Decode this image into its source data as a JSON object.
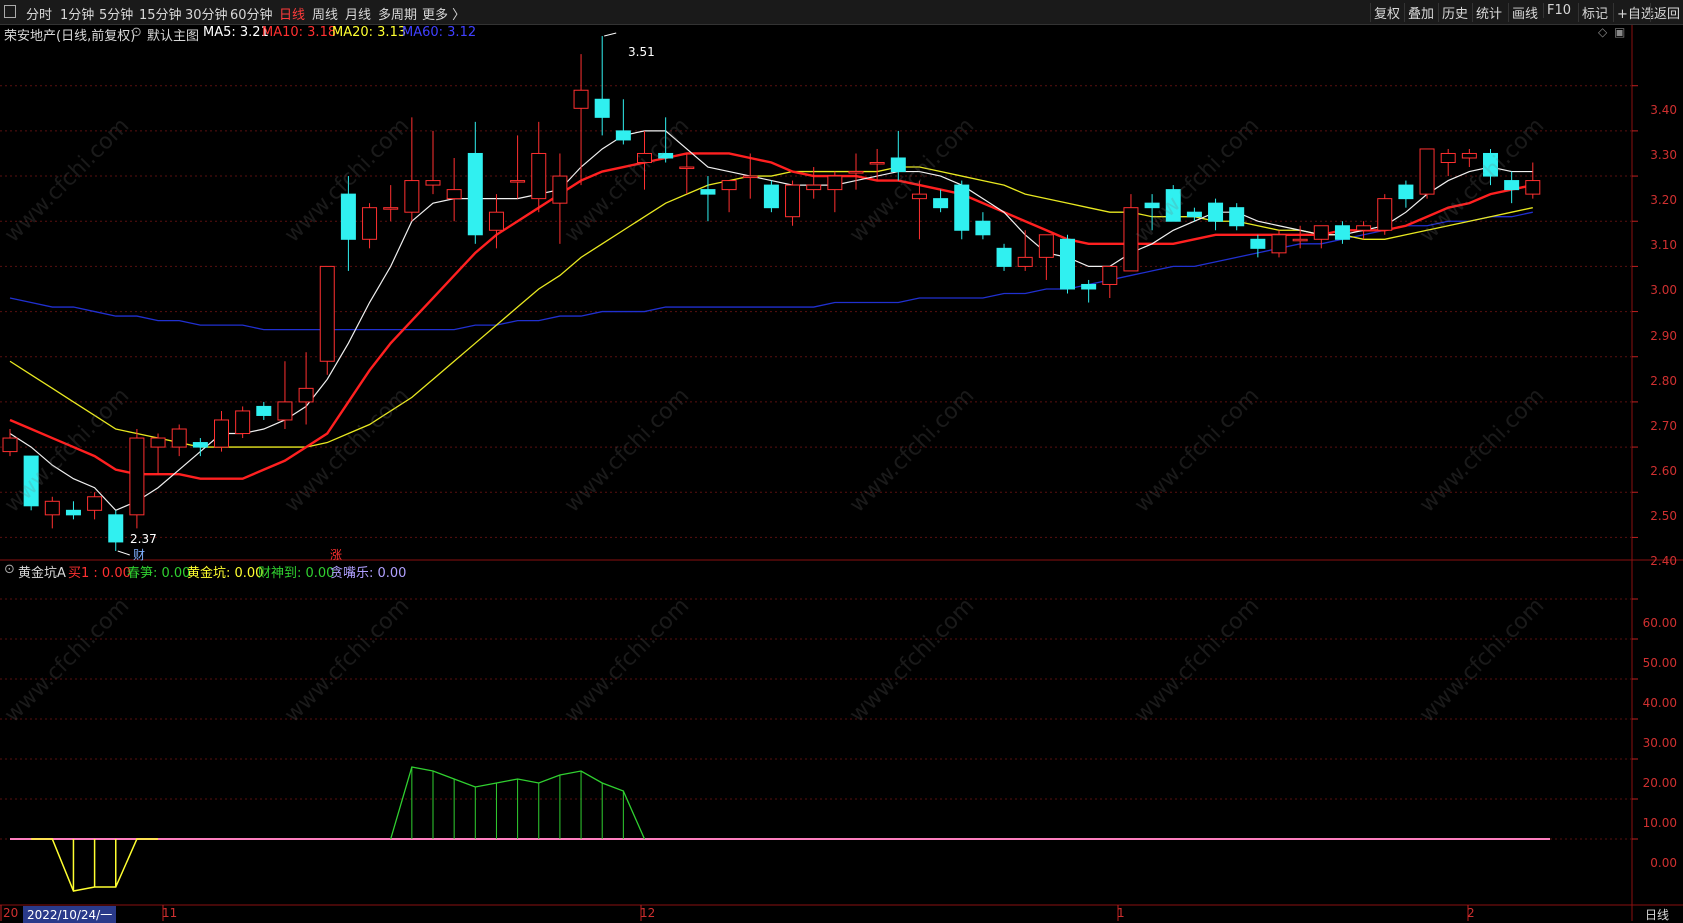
{
  "toolbar": {
    "left_items": [
      "分时",
      "1分钟",
      "5分钟",
      "15分钟",
      "30分钟",
      "60分钟",
      "日线",
      "周线",
      "月线",
      "多周期",
      "更多 〉"
    ],
    "active_item": "日线",
    "right_items": [
      "复权",
      "叠加",
      "历史",
      "统计",
      "画线",
      "F10",
      "标记",
      "+自选",
      "返回"
    ]
  },
  "main_panel": {
    "stock_name": "荣安地产(日线,前复权)",
    "indicator_name": "默认主图",
    "ma_labels": [
      {
        "text": "MA5: 3.21",
        "color": "#ffffff"
      },
      {
        "text": "MA10: 3.18",
        "color": "#ff3030"
      },
      {
        "text": "MA20: 3.13",
        "color": "#ffff30"
      },
      {
        "text": "MA60: 3.12",
        "color": "#4040ff"
      }
    ],
    "high_label": "3.51",
    "low_label": "2.37",
    "marker_cai": "财",
    "marker_zhang": "涨",
    "y_axis": [
      "3.40",
      "3.30",
      "3.20",
      "3.10",
      "3.00",
      "2.90",
      "2.80",
      "2.70",
      "2.60",
      "2.50",
      "2.40"
    ]
  },
  "sub_panel": {
    "indicator_name": "黄金坑A",
    "values": [
      {
        "text": "买1 : 0.00",
        "color": "#ff3030"
      },
      {
        "text": "春笋: 0.00",
        "color": "#30d030"
      },
      {
        "text": "黄金坑: 0.00",
        "color": "#ffff30"
      },
      {
        "text": "财神到: 0.00",
        "color": "#30d030"
      },
      {
        "text": "贪嘴乐: 0.00",
        "color": "#b0a0ff"
      }
    ],
    "y_axis": [
      "60.00",
      "50.00",
      "40.00",
      "30.00",
      "20.00",
      "10.00",
      "0.00"
    ]
  },
  "x_axis": {
    "date_label": "2022/10/24/一",
    "month_labels": [
      "20",
      "11",
      "12",
      "1",
      "2"
    ],
    "period_label": "日线"
  },
  "watermark": "www.cfchi.com",
  "chart_data": {
    "type": "candlestick",
    "title": "荣安地产(日线,前复权)",
    "ylim": [
      2.35,
      3.53
    ],
    "candles": [
      {
        "o": 2.59,
        "h": 2.64,
        "l": 2.58,
        "c": 2.62
      },
      {
        "o": 2.58,
        "h": 2.58,
        "l": 2.46,
        "c": 2.47
      },
      {
        "o": 2.45,
        "h": 2.49,
        "l": 2.42,
        "c": 2.48
      },
      {
        "o": 2.46,
        "h": 2.48,
        "l": 2.44,
        "c": 2.45
      },
      {
        "o": 2.46,
        "h": 2.5,
        "l": 2.44,
        "c": 2.49
      },
      {
        "o": 2.45,
        "h": 2.46,
        "l": 2.37,
        "c": 2.39
      },
      {
        "o": 2.45,
        "h": 2.64,
        "l": 2.42,
        "c": 2.62
      },
      {
        "o": 2.6,
        "h": 2.63,
        "l": 2.54,
        "c": 2.62
      },
      {
        "o": 2.6,
        "h": 2.65,
        "l": 2.58,
        "c": 2.64
      },
      {
        "o": 2.61,
        "h": 2.62,
        "l": 2.58,
        "c": 2.6
      },
      {
        "o": 2.6,
        "h": 2.68,
        "l": 2.59,
        "c": 2.66
      },
      {
        "o": 2.63,
        "h": 2.69,
        "l": 2.62,
        "c": 2.68
      },
      {
        "o": 2.69,
        "h": 2.7,
        "l": 2.66,
        "c": 2.67
      },
      {
        "o": 2.66,
        "h": 2.79,
        "l": 2.64,
        "c": 2.7
      },
      {
        "o": 2.7,
        "h": 2.81,
        "l": 2.65,
        "c": 2.73
      },
      {
        "o": 2.79,
        "h": 3.0,
        "l": 2.76,
        "c": 3.0
      },
      {
        "o": 3.16,
        "h": 3.2,
        "l": 2.99,
        "c": 3.06
      },
      {
        "o": 3.06,
        "h": 3.14,
        "l": 3.04,
        "c": 3.13
      },
      {
        "o": 3.13,
        "h": 3.18,
        "l": 3.1,
        "c": 3.13
      },
      {
        "o": 3.12,
        "h": 3.33,
        "l": 3.1,
        "c": 3.19
      },
      {
        "o": 3.18,
        "h": 3.3,
        "l": 3.16,
        "c": 3.19
      },
      {
        "o": 3.15,
        "h": 3.24,
        "l": 3.1,
        "c": 3.17
      },
      {
        "o": 3.25,
        "h": 3.32,
        "l": 3.05,
        "c": 3.07
      },
      {
        "o": 3.08,
        "h": 3.16,
        "l": 3.04,
        "c": 3.12
      },
      {
        "o": 3.19,
        "h": 3.29,
        "l": 3.15,
        "c": 3.19
      },
      {
        "o": 3.15,
        "h": 3.32,
        "l": 3.12,
        "c": 3.25
      },
      {
        "o": 3.14,
        "h": 3.25,
        "l": 3.05,
        "c": 3.2
      },
      {
        "o": 3.35,
        "h": 3.47,
        "l": 3.18,
        "c": 3.39
      },
      {
        "o": 3.37,
        "h": 3.51,
        "l": 3.29,
        "c": 3.33
      },
      {
        "o": 3.3,
        "h": 3.37,
        "l": 3.27,
        "c": 3.28
      },
      {
        "o": 3.23,
        "h": 3.3,
        "l": 3.17,
        "c": 3.25
      },
      {
        "o": 3.25,
        "h": 3.33,
        "l": 3.23,
        "c": 3.24
      },
      {
        "o": 3.22,
        "h": 3.25,
        "l": 3.16,
        "c": 3.22
      },
      {
        "o": 3.17,
        "h": 3.2,
        "l": 3.1,
        "c": 3.16
      },
      {
        "o": 3.17,
        "h": 3.19,
        "l": 3.12,
        "c": 3.19
      },
      {
        "o": 3.2,
        "h": 3.25,
        "l": 3.15,
        "c": 3.2
      },
      {
        "o": 3.18,
        "h": 3.19,
        "l": 3.12,
        "c": 3.13
      },
      {
        "o": 3.11,
        "h": 3.19,
        "l": 3.09,
        "c": 3.18
      },
      {
        "o": 3.17,
        "h": 3.22,
        "l": 3.15,
        "c": 3.18
      },
      {
        "o": 3.17,
        "h": 3.21,
        "l": 3.12,
        "c": 3.2
      },
      {
        "o": 3.21,
        "h": 3.25,
        "l": 3.17,
        "c": 3.21
      },
      {
        "o": 3.23,
        "h": 3.26,
        "l": 3.19,
        "c": 3.23
      },
      {
        "o": 3.24,
        "h": 3.3,
        "l": 3.19,
        "c": 3.21
      },
      {
        "o": 3.15,
        "h": 3.19,
        "l": 3.06,
        "c": 3.16
      },
      {
        "o": 3.15,
        "h": 3.17,
        "l": 3.12,
        "c": 3.13
      },
      {
        "o": 3.18,
        "h": 3.19,
        "l": 3.06,
        "c": 3.08
      },
      {
        "o": 3.1,
        "h": 3.12,
        "l": 3.06,
        "c": 3.07
      },
      {
        "o": 3.04,
        "h": 3.05,
        "l": 2.99,
        "c": 3.0
      },
      {
        "o": 3.0,
        "h": 3.08,
        "l": 2.99,
        "c": 3.02
      },
      {
        "o": 3.02,
        "h": 3.07,
        "l": 2.97,
        "c": 3.07
      },
      {
        "o": 3.06,
        "h": 3.07,
        "l": 2.94,
        "c": 2.95
      },
      {
        "o": 2.96,
        "h": 2.97,
        "l": 2.92,
        "c": 2.95
      },
      {
        "o": 2.96,
        "h": 3.0,
        "l": 2.93,
        "c": 3.0
      },
      {
        "o": 2.99,
        "h": 3.16,
        "l": 2.99,
        "c": 3.13
      },
      {
        "o": 3.14,
        "h": 3.16,
        "l": 3.08,
        "c": 3.13
      },
      {
        "o": 3.17,
        "h": 3.18,
        "l": 3.1,
        "c": 3.1
      },
      {
        "o": 3.12,
        "h": 3.13,
        "l": 3.1,
        "c": 3.11
      },
      {
        "o": 3.14,
        "h": 3.15,
        "l": 3.08,
        "c": 3.1
      },
      {
        "o": 3.13,
        "h": 3.14,
        "l": 3.08,
        "c": 3.09
      },
      {
        "o": 3.06,
        "h": 3.07,
        "l": 3.02,
        "c": 3.04
      },
      {
        "o": 3.03,
        "h": 3.08,
        "l": 3.02,
        "c": 3.07
      },
      {
        "o": 3.06,
        "h": 3.09,
        "l": 3.04,
        "c": 3.06
      },
      {
        "o": 3.06,
        "h": 3.09,
        "l": 3.04,
        "c": 3.09
      },
      {
        "o": 3.09,
        "h": 3.1,
        "l": 3.05,
        "c": 3.06
      },
      {
        "o": 3.08,
        "h": 3.1,
        "l": 3.06,
        "c": 3.09
      },
      {
        "o": 3.08,
        "h": 3.16,
        "l": 3.07,
        "c": 3.15
      },
      {
        "o": 3.18,
        "h": 3.19,
        "l": 3.13,
        "c": 3.15
      },
      {
        "o": 3.16,
        "h": 3.26,
        "l": 3.15,
        "c": 3.26
      },
      {
        "o": 3.23,
        "h": 3.26,
        "l": 3.2,
        "c": 3.25
      },
      {
        "o": 3.24,
        "h": 3.26,
        "l": 3.22,
        "c": 3.25
      },
      {
        "o": 3.25,
        "h": 3.26,
        "l": 3.18,
        "c": 3.2
      },
      {
        "o": 3.19,
        "h": 3.21,
        "l": 3.14,
        "c": 3.17
      },
      {
        "o": 3.16,
        "h": 3.23,
        "l": 3.15,
        "c": 3.19
      }
    ],
    "ma5": [
      2.63,
      2.6,
      2.56,
      2.53,
      2.51,
      2.46,
      2.48,
      2.51,
      2.55,
      2.59,
      2.63,
      2.63,
      2.64,
      2.66,
      2.69,
      2.75,
      2.83,
      2.92,
      3.0,
      3.1,
      3.14,
      3.15,
      3.15,
      3.15,
      3.15,
      3.16,
      3.17,
      3.22,
      3.26,
      3.29,
      3.3,
      3.3,
      3.26,
      3.22,
      3.21,
      3.2,
      3.19,
      3.18,
      3.18,
      3.18,
      3.19,
      3.2,
      3.21,
      3.21,
      3.2,
      3.18,
      3.15,
      3.12,
      3.07,
      3.03,
      3.02,
      3.0,
      3.0,
      3.03,
      3.05,
      3.08,
      3.1,
      3.12,
      3.12,
      3.1,
      3.09,
      3.08,
      3.07,
      3.07,
      3.08,
      3.09,
      3.12,
      3.16,
      3.19,
      3.21,
      3.22,
      3.21,
      3.21
    ],
    "ma10": [
      2.66,
      2.64,
      2.62,
      2.6,
      2.58,
      2.55,
      2.54,
      2.54,
      2.54,
      2.53,
      2.53,
      2.53,
      2.55,
      2.57,
      2.6,
      2.63,
      2.7,
      2.77,
      2.83,
      2.88,
      2.93,
      2.98,
      3.03,
      3.07,
      3.1,
      3.13,
      3.16,
      3.19,
      3.21,
      3.22,
      3.23,
      3.24,
      3.25,
      3.25,
      3.25,
      3.24,
      3.23,
      3.21,
      3.2,
      3.2,
      3.2,
      3.19,
      3.19,
      3.18,
      3.17,
      3.16,
      3.14,
      3.12,
      3.1,
      3.08,
      3.06,
      3.05,
      3.05,
      3.05,
      3.05,
      3.05,
      3.06,
      3.07,
      3.07,
      3.07,
      3.07,
      3.07,
      3.07,
      3.08,
      3.08,
      3.08,
      3.09,
      3.11,
      3.13,
      3.14,
      3.16,
      3.17,
      3.18
    ],
    "ma20": [
      2.79,
      2.76,
      2.73,
      2.7,
      2.67,
      2.64,
      2.63,
      2.62,
      2.61,
      2.6,
      2.6,
      2.6,
      2.6,
      2.6,
      2.6,
      2.61,
      2.63,
      2.65,
      2.68,
      2.71,
      2.75,
      2.79,
      2.83,
      2.87,
      2.91,
      2.95,
      2.98,
      3.02,
      3.05,
      3.08,
      3.11,
      3.14,
      3.16,
      3.18,
      3.19,
      3.2,
      3.2,
      3.21,
      3.21,
      3.21,
      3.21,
      3.21,
      3.22,
      3.22,
      3.21,
      3.2,
      3.19,
      3.18,
      3.16,
      3.15,
      3.14,
      3.13,
      3.12,
      3.12,
      3.11,
      3.11,
      3.11,
      3.1,
      3.1,
      3.09,
      3.08,
      3.08,
      3.07,
      3.07,
      3.06,
      3.06,
      3.07,
      3.08,
      3.09,
      3.1,
      3.11,
      3.12,
      3.13
    ],
    "ma60": [
      2.93,
      2.92,
      2.91,
      2.91,
      2.9,
      2.89,
      2.89,
      2.88,
      2.88,
      2.87,
      2.87,
      2.87,
      2.86,
      2.86,
      2.86,
      2.86,
      2.86,
      2.86,
      2.86,
      2.86,
      2.86,
      2.86,
      2.87,
      2.87,
      2.88,
      2.88,
      2.89,
      2.89,
      2.9,
      2.9,
      2.9,
      2.91,
      2.91,
      2.91,
      2.91,
      2.91,
      2.91,
      2.91,
      2.91,
      2.92,
      2.92,
      2.92,
      2.92,
      2.93,
      2.93,
      2.93,
      2.93,
      2.94,
      2.94,
      2.95,
      2.95,
      2.96,
      2.97,
      2.98,
      2.99,
      3.0,
      3.0,
      3.01,
      3.02,
      3.03,
      3.04,
      3.05,
      3.05,
      3.06,
      3.07,
      3.08,
      3.09,
      3.09,
      3.1,
      3.1,
      3.11,
      3.11,
      3.12
    ],
    "sub_ylim": [
      -14,
      66
    ],
    "yellow_values": [
      0,
      0,
      -13,
      -12,
      -12,
      0,
      0
    ],
    "green_values": [
      0,
      18,
      17,
      15,
      13,
      14,
      15,
      14,
      16,
      17,
      14,
      12,
      0
    ],
    "green_start_index": 18,
    "zero_line_color": "#ff80c0"
  }
}
